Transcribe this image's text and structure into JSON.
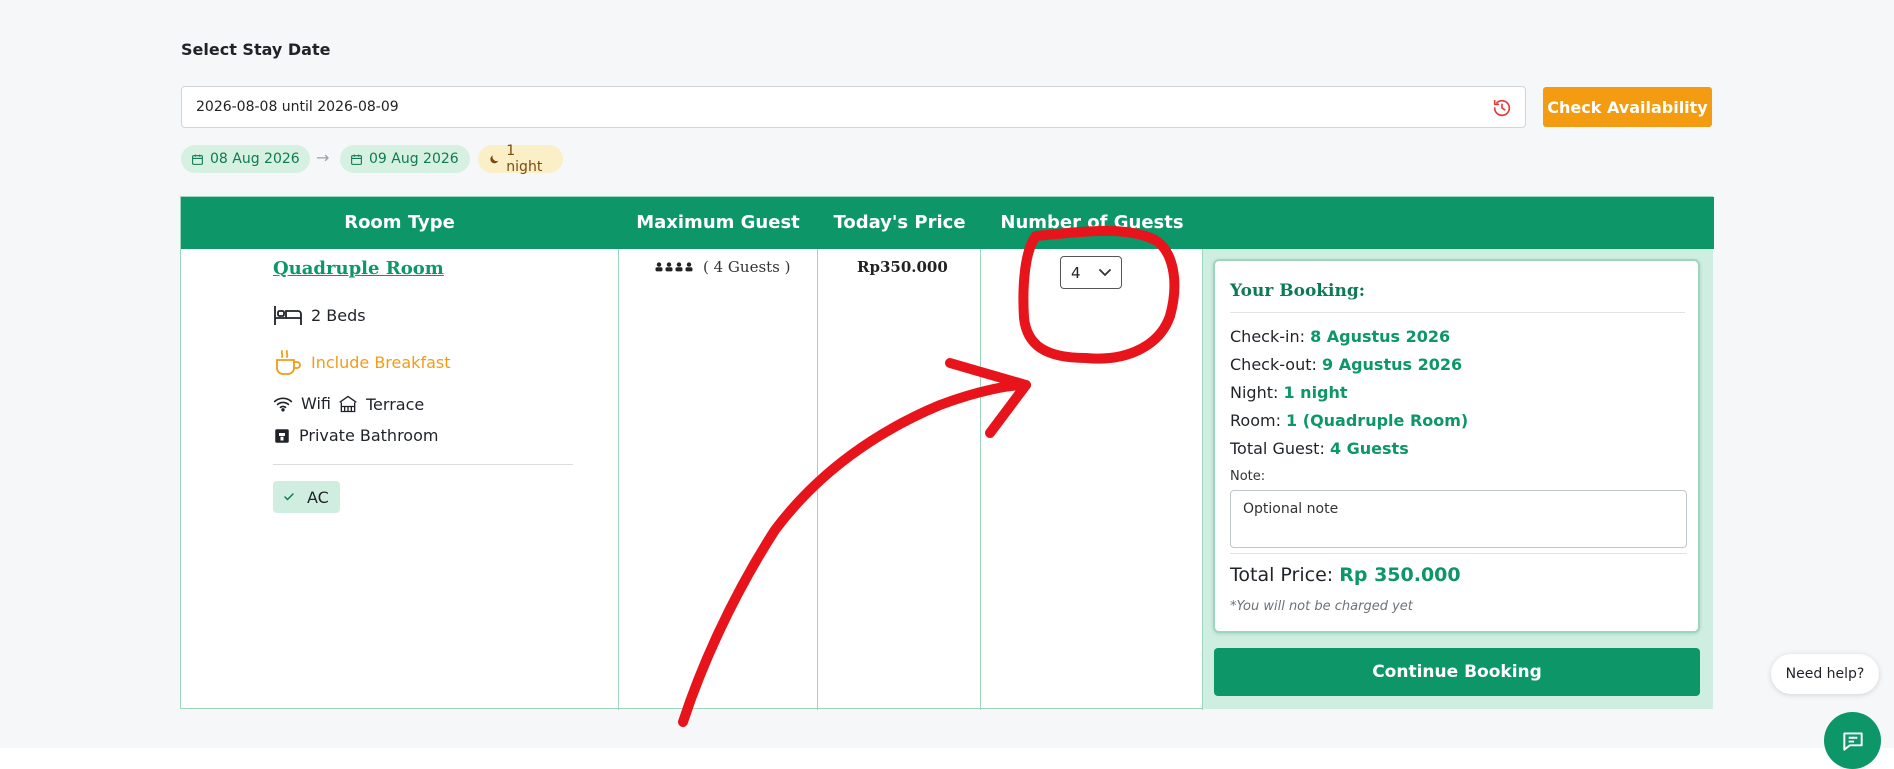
{
  "header": {
    "section_title": "Select Stay Date"
  },
  "date_range": {
    "value": "2026-08-08 until 2026-08-09"
  },
  "actions": {
    "check_availability": "Check Availability",
    "continue_booking": "Continue Booking"
  },
  "summary_pills": {
    "checkin": "08 Aug 2026",
    "arrow": "→",
    "checkout": "09 Aug 2026",
    "nights": "1 night"
  },
  "table": {
    "headers": [
      "Room Type",
      "Maximum Guest",
      "Today's Price",
      "Number of Guests"
    ]
  },
  "room": {
    "name": "Quadruple Room",
    "beds": "2 Beds",
    "breakfast": "Include Breakfast",
    "amenity_wifi": "Wifi",
    "amenity_terrace": "Terrace",
    "amenity_bathroom": "Private Bathroom",
    "badge_ac": "AC",
    "max_guest_text": "( 4 Guests )",
    "price": "Rp350.000",
    "selected_guests": "4"
  },
  "booking": {
    "title": "Your Booking:",
    "checkin_label": "Check-in:",
    "checkin_value": "8 Agustus 2026",
    "checkout_label": "Check-out:",
    "checkout_value": "9 Agustus 2026",
    "night_label": "Night:",
    "night_value": "1 night",
    "room_label": "Room:",
    "room_value": "1 (Quadruple Room)",
    "guest_label": "Total Guest:",
    "guest_value": "4 Guests",
    "note_label": "Note:",
    "note_placeholder": "Optional note",
    "total_label": "Total Price:",
    "total_value": "Rp 350.000",
    "disclaimer": "*You will not be charged yet"
  },
  "help": {
    "label": "Need help?"
  },
  "colors": {
    "primary": "#0d9668",
    "accent": "#f39c12",
    "annotation": "#e8141b"
  }
}
